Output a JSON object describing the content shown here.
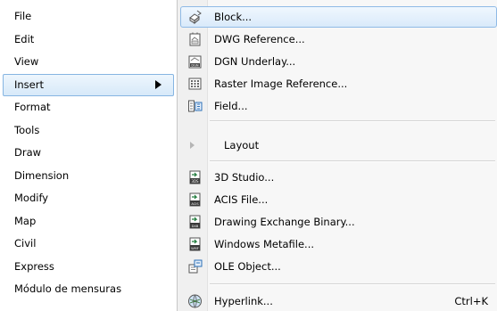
{
  "menubar": {
    "items": [
      {
        "label": "File"
      },
      {
        "label": "Edit"
      },
      {
        "label": "View"
      },
      {
        "label": "Insert"
      },
      {
        "label": "Format"
      },
      {
        "label": "Tools"
      },
      {
        "label": "Draw"
      },
      {
        "label": "Dimension"
      },
      {
        "label": "Modify"
      },
      {
        "label": "Map"
      },
      {
        "label": "Civil"
      },
      {
        "label": "Express"
      },
      {
        "label": "Módulo de mensuras"
      }
    ],
    "active_index": 3
  },
  "submenu": {
    "items": [
      {
        "label": "Block...",
        "icon": "block-icon"
      },
      {
        "label": "DWG Reference...",
        "icon": "dwg-reference-icon"
      },
      {
        "label": "DGN Underlay...",
        "icon": "dgn-underlay-icon"
      },
      {
        "label": "Raster Image Reference...",
        "icon": "raster-image-icon"
      },
      {
        "label": "Field...",
        "icon": "field-icon"
      },
      {
        "label": "Layout",
        "icon": "submenu-arrow-icon"
      },
      {
        "label": "3D Studio...",
        "icon": "3ds-import-icon"
      },
      {
        "label": "ACIS File...",
        "icon": "acis-import-icon"
      },
      {
        "label": "Drawing Exchange Binary...",
        "icon": "dxb-import-icon"
      },
      {
        "label": "Windows Metafile...",
        "icon": "wmf-import-icon"
      },
      {
        "label": "OLE Object...",
        "icon": "ole-object-icon"
      },
      {
        "label": "Hyperlink...",
        "icon": "hyperlink-icon",
        "shortcut": "Ctrl+K"
      }
    ]
  },
  "colors": {
    "highlight_border": "#8fbae6",
    "highlight_fill": "#d9eafa",
    "submenu_bg": "#f7f7f7"
  }
}
